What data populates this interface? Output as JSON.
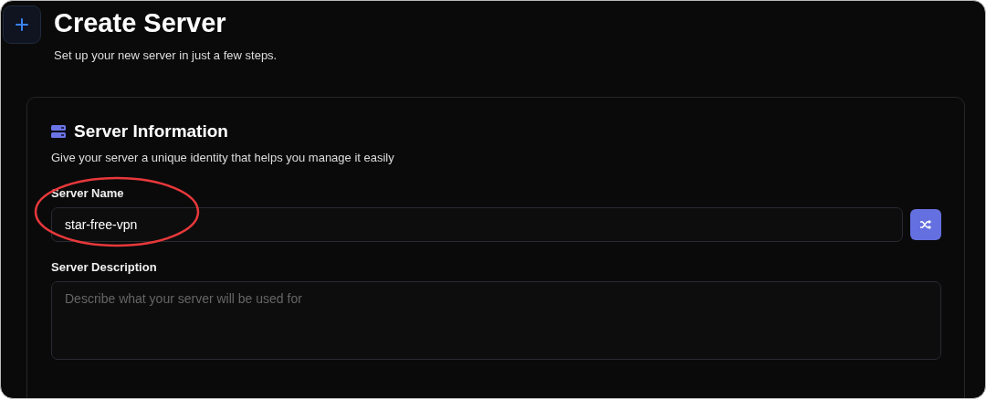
{
  "header": {
    "title": "Create Server",
    "subtitle": "Set up your new server in just a few steps."
  },
  "section": {
    "title": "Server Information",
    "description": "Give your server a unique identity that helps you manage it easily",
    "fields": [
      {
        "kind": "text",
        "label": "Server Name",
        "value": "star-free-vpn",
        "has_random_button": true
      },
      {
        "kind": "textarea",
        "label": "Server Description",
        "placeholder": "Describe what your server will be used for",
        "has_random_button": false
      }
    ]
  },
  "annotations": [
    {
      "kind": "ellipse",
      "color": "#e8383b"
    }
  ]
}
